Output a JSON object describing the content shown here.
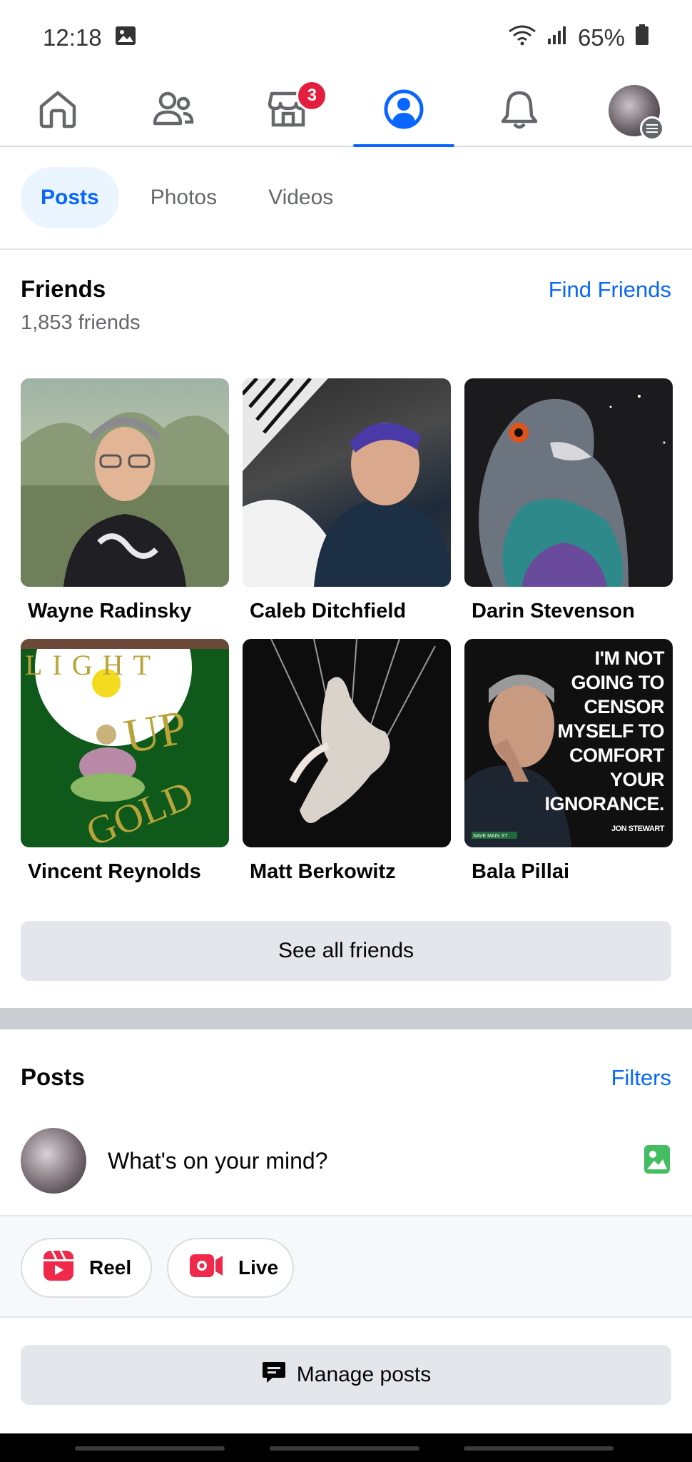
{
  "status_bar": {
    "time": "12:18",
    "battery": "65%",
    "icons": [
      "gallery-icon",
      "wifi-icon",
      "signal-icon",
      "battery-icon"
    ]
  },
  "nav": {
    "items": [
      {
        "name": "home",
        "icon": "home-icon"
      },
      {
        "name": "friends",
        "icon": "friends-icon"
      },
      {
        "name": "marketplace",
        "icon": "marketplace-icon",
        "badge": "3"
      },
      {
        "name": "profile",
        "icon": "profile-icon",
        "active": true
      },
      {
        "name": "notifications",
        "icon": "bell-icon"
      },
      {
        "name": "menu",
        "icon": "avatar-menu-icon"
      }
    ],
    "accent": "#0866ff"
  },
  "tabs": {
    "posts": "Posts",
    "photos": "Photos",
    "videos": "Videos"
  },
  "friends": {
    "title": "Friends",
    "count": "1,853 friends",
    "find_link": "Find Friends",
    "list": [
      {
        "name": "Wayne Radinsky"
      },
      {
        "name": "Caleb Ditchfield"
      },
      {
        "name": "Darin Stevenson"
      },
      {
        "name": "Vincent Reynolds"
      },
      {
        "name": "Matt Berkowitz"
      },
      {
        "name": "Bala Pillai"
      }
    ],
    "see_all": "See all friends"
  },
  "photo_text": {
    "vincent_line1": "LIGHT",
    "vincent_line2": "UP",
    "vincent_line3": "GOLD",
    "bala_quote": [
      "I'M NOT",
      "GOING TO",
      "CENSOR",
      "MYSELF TO",
      "COMFORT",
      "YOUR",
      "IGNORANCE."
    ],
    "bala_attribution": "JON STEWART",
    "bala_sign": "SAVE MAIN ST"
  },
  "posts": {
    "title": "Posts",
    "filters": "Filters",
    "composer_placeholder": "What's on your mind?",
    "reel": "Reel",
    "live": "Live",
    "manage": "Manage posts"
  }
}
